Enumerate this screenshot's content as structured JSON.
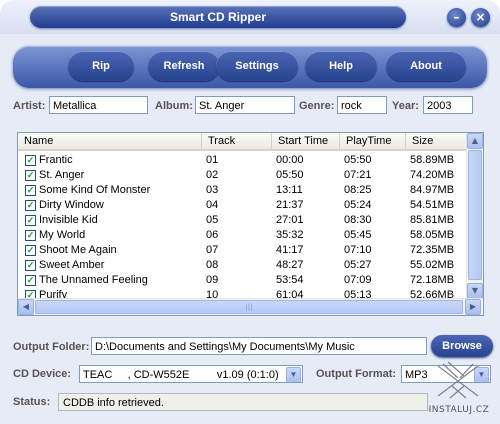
{
  "window": {
    "title": "Smart CD Ripper",
    "minimize_label": "–",
    "close_label": "×"
  },
  "toolbar": {
    "buttons": [
      {
        "label": "Rip"
      },
      {
        "label": "Refresh"
      },
      {
        "label": "Settings"
      },
      {
        "label": "Help"
      },
      {
        "label": "About"
      }
    ]
  },
  "album_info": {
    "artist_label": "Artist:",
    "artist_value": "Metallica",
    "album_label": "Album:",
    "album_value": "St. Anger",
    "genre_label": "Genre:",
    "genre_value": "rock",
    "year_label": "Year:",
    "year_value": "2003"
  },
  "track_list": {
    "columns": [
      "Name",
      "Track",
      "Start Time",
      "PlayTime",
      "Size"
    ],
    "check_mark": "✓",
    "rows": [
      {
        "name": "Frantic",
        "track": "01",
        "start": "00:00",
        "play": "05:50",
        "size": "58.89MB"
      },
      {
        "name": "St. Anger",
        "track": "02",
        "start": "05:50",
        "play": "07:21",
        "size": "74.20MB"
      },
      {
        "name": "Some Kind Of Monster",
        "track": "03",
        "start": "13:11",
        "play": "08:25",
        "size": "84.97MB"
      },
      {
        "name": "Dirty Window",
        "track": "04",
        "start": "21:37",
        "play": "05:24",
        "size": "54.51MB"
      },
      {
        "name": "Invisible Kid",
        "track": "05",
        "start": "27:01",
        "play": "08:30",
        "size": "85.81MB"
      },
      {
        "name": "My World",
        "track": "06",
        "start": "35:32",
        "play": "05:45",
        "size": "58.05MB"
      },
      {
        "name": "Shoot Me Again",
        "track": "07",
        "start": "41:17",
        "play": "07:10",
        "size": "72.35MB"
      },
      {
        "name": "Sweet Amber",
        "track": "08",
        "start": "48:27",
        "play": "05:27",
        "size": "55.02MB"
      },
      {
        "name": "The Unnamed Feeling",
        "track": "09",
        "start": "53:54",
        "play": "07:09",
        "size": "72.18MB"
      },
      {
        "name": "Purify",
        "track": "10",
        "start": "61:04",
        "play": "05:13",
        "size": "52.66MB"
      }
    ]
  },
  "output": {
    "folder_label": "Output Folder:",
    "folder_value": "D:\\Documents and Settings\\My Documents\\My Music",
    "browse_label": "Browse"
  },
  "device": {
    "label": "CD Device:",
    "value": "TEAC     , CD-W552E         v1.09 (0:1:0)",
    "format_label": "Output Format:",
    "format_value": "MP3"
  },
  "status": {
    "label": "Status:",
    "value": "CDDB info retrieved."
  },
  "watermark": {
    "text": "INSTALUJ.CZ"
  },
  "colors": {
    "title_bar": "#1f3c8f",
    "toolbar": "#3b58a8",
    "background": "#e6ebf6"
  }
}
